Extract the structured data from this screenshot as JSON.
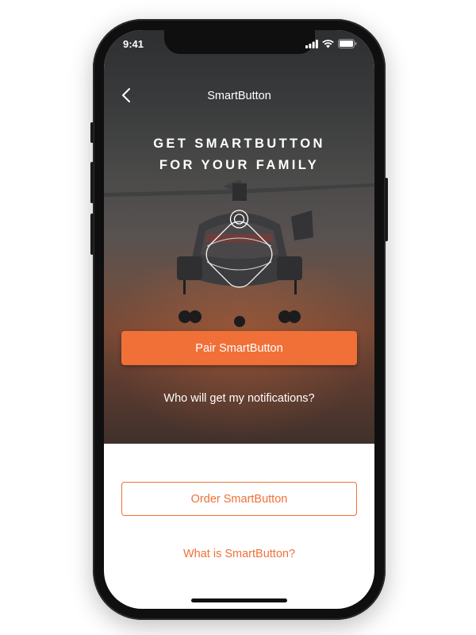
{
  "status_bar": {
    "time": "9:41",
    "icons": [
      "signal-icon",
      "wifi-icon",
      "battery-icon"
    ]
  },
  "nav": {
    "title": "SmartButton",
    "back_icon": "chevron-left-icon"
  },
  "hero": {
    "headline_line1": "GET SMARTBUTTON",
    "headline_line2": "FOR YOUR FAMILY",
    "device_icon": "smartbutton-device-icon"
  },
  "actions": {
    "pair_label": "Pair SmartButton",
    "notifications_link": "Who will get my notifications?",
    "order_label": "Order SmartButton",
    "what_is_link": "What is SmartButton?"
  },
  "colors": {
    "accent": "#f07038",
    "text_light": "#ffffff"
  }
}
